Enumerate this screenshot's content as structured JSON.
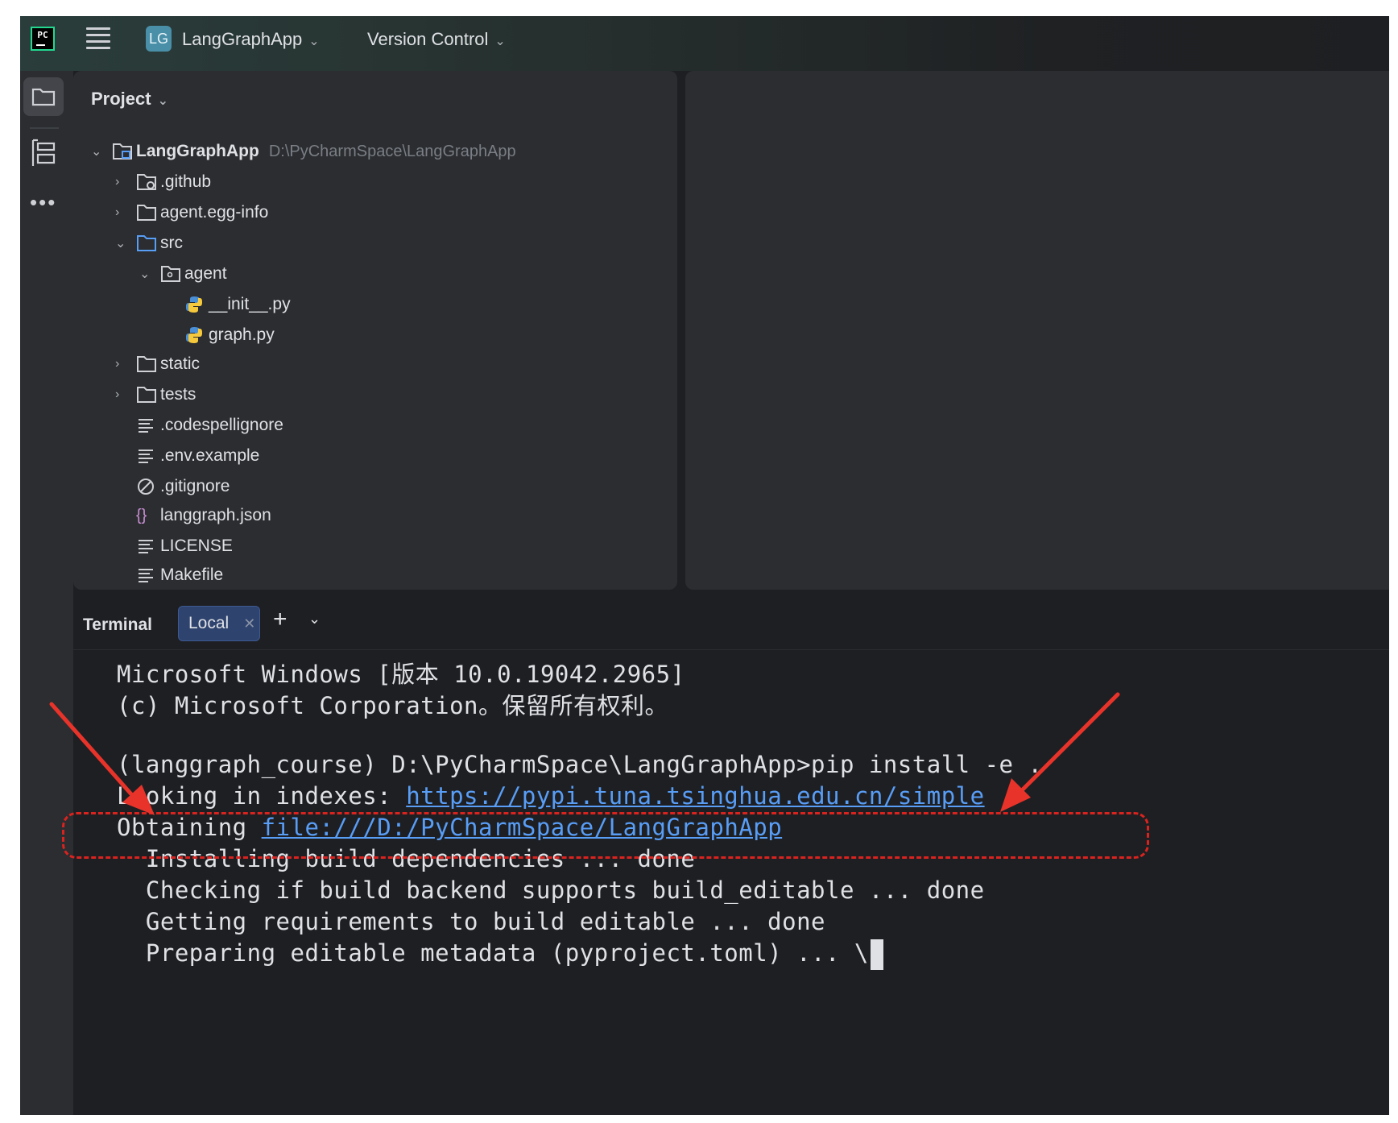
{
  "header": {
    "logo": "PC",
    "project_badge": "LG",
    "project_name": "LangGraphApp",
    "version_control": "Version Control"
  },
  "project_panel": {
    "title": "Project",
    "root_name": "LangGraphApp",
    "root_path": "D:\\PyCharmSpace\\LangGraphApp",
    "items": [
      {
        "label": ".github"
      },
      {
        "label": "agent.egg-info"
      },
      {
        "label": "src"
      },
      {
        "label": "agent"
      },
      {
        "label": "__init__.py"
      },
      {
        "label": "graph.py"
      },
      {
        "label": "static"
      },
      {
        "label": "tests"
      },
      {
        "label": ".codespellignore"
      },
      {
        "label": ".env.example"
      },
      {
        "label": ".gitignore"
      },
      {
        "label": "langgraph.json"
      },
      {
        "label": "LICENSE"
      },
      {
        "label": "Makefile"
      }
    ]
  },
  "terminal": {
    "title": "Terminal",
    "tab_label": "Local",
    "lines": [
      "Microsoft Windows [版本 10.0.19042.2965]",
      "(c) Microsoft Corporation。保留所有权利。",
      "(langgraph_course) D:\\PyCharmSpace\\LangGraphApp>pip install -e .",
      "Looking in indexes: ",
      "https://pypi.tuna.tsinghua.edu.cn/simple",
      "Obtaining ",
      "file:///D:/PyCharmSpace/LangGraphApp",
      "  Installing build dependencies ... done",
      "  Checking if build backend supports build_editable ... done",
      "  Getting requirements to build editable ... done",
      "  Preparing editable metadata (pyproject.toml) ... \\"
    ]
  },
  "colors": {
    "background": "#1e1f22",
    "panel": "#2b2d30",
    "text": "#dfe1e5",
    "link": "#589df6",
    "annotation": "#d9231f"
  }
}
